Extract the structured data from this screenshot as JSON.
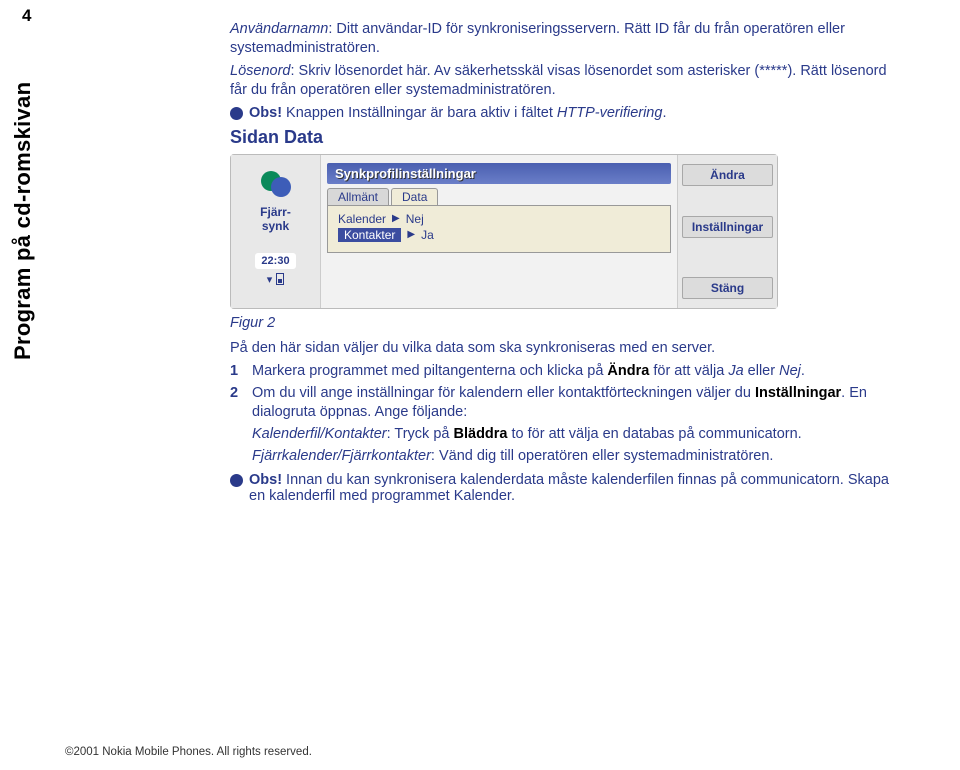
{
  "page_number": "4",
  "side_tab": "Program på cd-romskivan",
  "p1_label": "Användarnamn",
  "p1_rest": ": Ditt användar-ID för synkroniseringsservern. Rätt ID får du från operatören eller systemadministratören.",
  "p2_label": "Lösenord",
  "p2_rest": ": Skriv lösenordet här. Av säkerhetsskäl visas lösenordet som asterisker (*****). Rätt lösenord får du från operatören eller systemadministratören.",
  "obs1_label": "Obs!",
  "obs1_rest": " Knappen Inställningar är bara aktiv i fältet ",
  "obs1_field": "HTTP-verifiering",
  "obs1_end": ".",
  "h2": "Sidan Data",
  "device": {
    "left_label": "Fjärr-\nsynk",
    "time": "22:30",
    "title": "Synkprofilinställningar",
    "tab_allmant": "Allmänt",
    "tab_data": "Data",
    "row1_label": "Kalender",
    "row1_val": "Nej",
    "row2_label": "Kontakter",
    "row2_val": "Ja",
    "btn_andra": "Ändra",
    "btn_installningar": "Inställningar",
    "btn_stang": "Stäng"
  },
  "figure_label": "Figur 2",
  "p_after": "På den här sidan väljer du vilka data som ska synkroniseras med en server.",
  "step1_pre": "Markera programmet med piltangenterna och klicka på ",
  "step1_bold": "Ändra",
  "step1_mid": " för att välja ",
  "step1_i1": "Ja",
  "step1_or": " eller ",
  "step1_i2": "Nej",
  "step1_end": ".",
  "step2_pre": "Om du vill ange inställningar för kalendern eller kontaktförteckningen väljer du ",
  "step2_bold": "Inställningar",
  "step2_rest": ". En dialogruta öppnas. Ange följande:",
  "sub1_label": "Kalenderfil/Kontakter",
  "sub1_mid": ": Tryck på ",
  "sub1_bold": "Bläddra",
  "sub1_rest": " to för att välja en databas på communicatorn.",
  "sub2_label": "Fjärrkalender/Fjärrkontakter",
  "sub2_rest": ": Vänd dig till operatören eller systemadministratören.",
  "obs2_label": "Obs!",
  "obs2_rest": " Innan du kan synkronisera kalenderdata måste kalenderfilen finnas på communicatorn. Skapa en kalenderfil med programmet Kalender.",
  "footer": "©2001 Nokia Mobile Phones. All rights reserved."
}
